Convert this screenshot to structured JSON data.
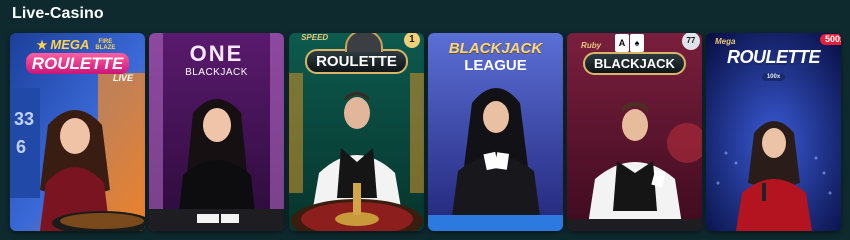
{
  "section": {
    "title": "Live-Casino"
  },
  "games": [
    {
      "logo_top": "MEGA",
      "logo_side": "FIRE BLAZE",
      "logo_main": "ROULETTE",
      "logo_sub": "LIVE",
      "side_numbers": [
        "33",
        "6"
      ]
    },
    {
      "logo_main": "ONE",
      "logo_sub": "BLACKJACK"
    },
    {
      "logo_top": "SPEED",
      "logo_main": "ROULETTE",
      "badge": "1"
    },
    {
      "logo_main": "BLACKJACK",
      "logo_sub": "LEAGUE"
    },
    {
      "logo_top": "Ruby",
      "logo_main": "BLACKJACK",
      "badge": "77"
    },
    {
      "logo_top": "Mega",
      "logo_main": "ROULETTE",
      "badge": "500x",
      "multiplier": "100x"
    }
  ],
  "colors": {
    "page_bg": "#0f2a2f",
    "title": "#ffffff"
  },
  "icons": [
    "roulette-wheel-icon",
    "playing-cards-icon"
  ]
}
